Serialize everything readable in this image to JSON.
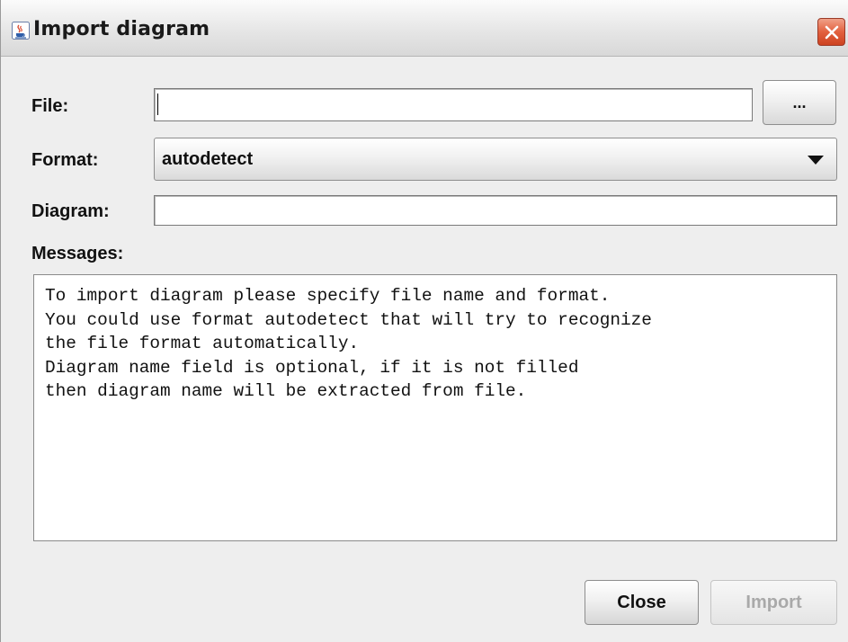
{
  "window": {
    "title": "Import diagram",
    "title_icon": "java-cup-icon",
    "close_icon": "close-icon"
  },
  "form": {
    "file_label": "File:",
    "file_value": "",
    "browse_label": "...",
    "format_label": "Format:",
    "format_value": "autodetect",
    "diagram_label": "Diagram:",
    "diagram_value": "",
    "messages_label": "Messages:"
  },
  "messages": {
    "lines": [
      "To import diagram please specify file name and format.",
      "You could use format autodetect that will try to recognize",
      "the file format automatically.",
      "Diagram name field is optional, if it is not filled",
      "then diagram name will be extracted from file."
    ]
  },
  "buttons": {
    "close_label": "Close",
    "import_label": "Import",
    "import_enabled": false
  },
  "colors": {
    "close_button": "#e2603e",
    "disabled_text": "#a9a9a9"
  }
}
